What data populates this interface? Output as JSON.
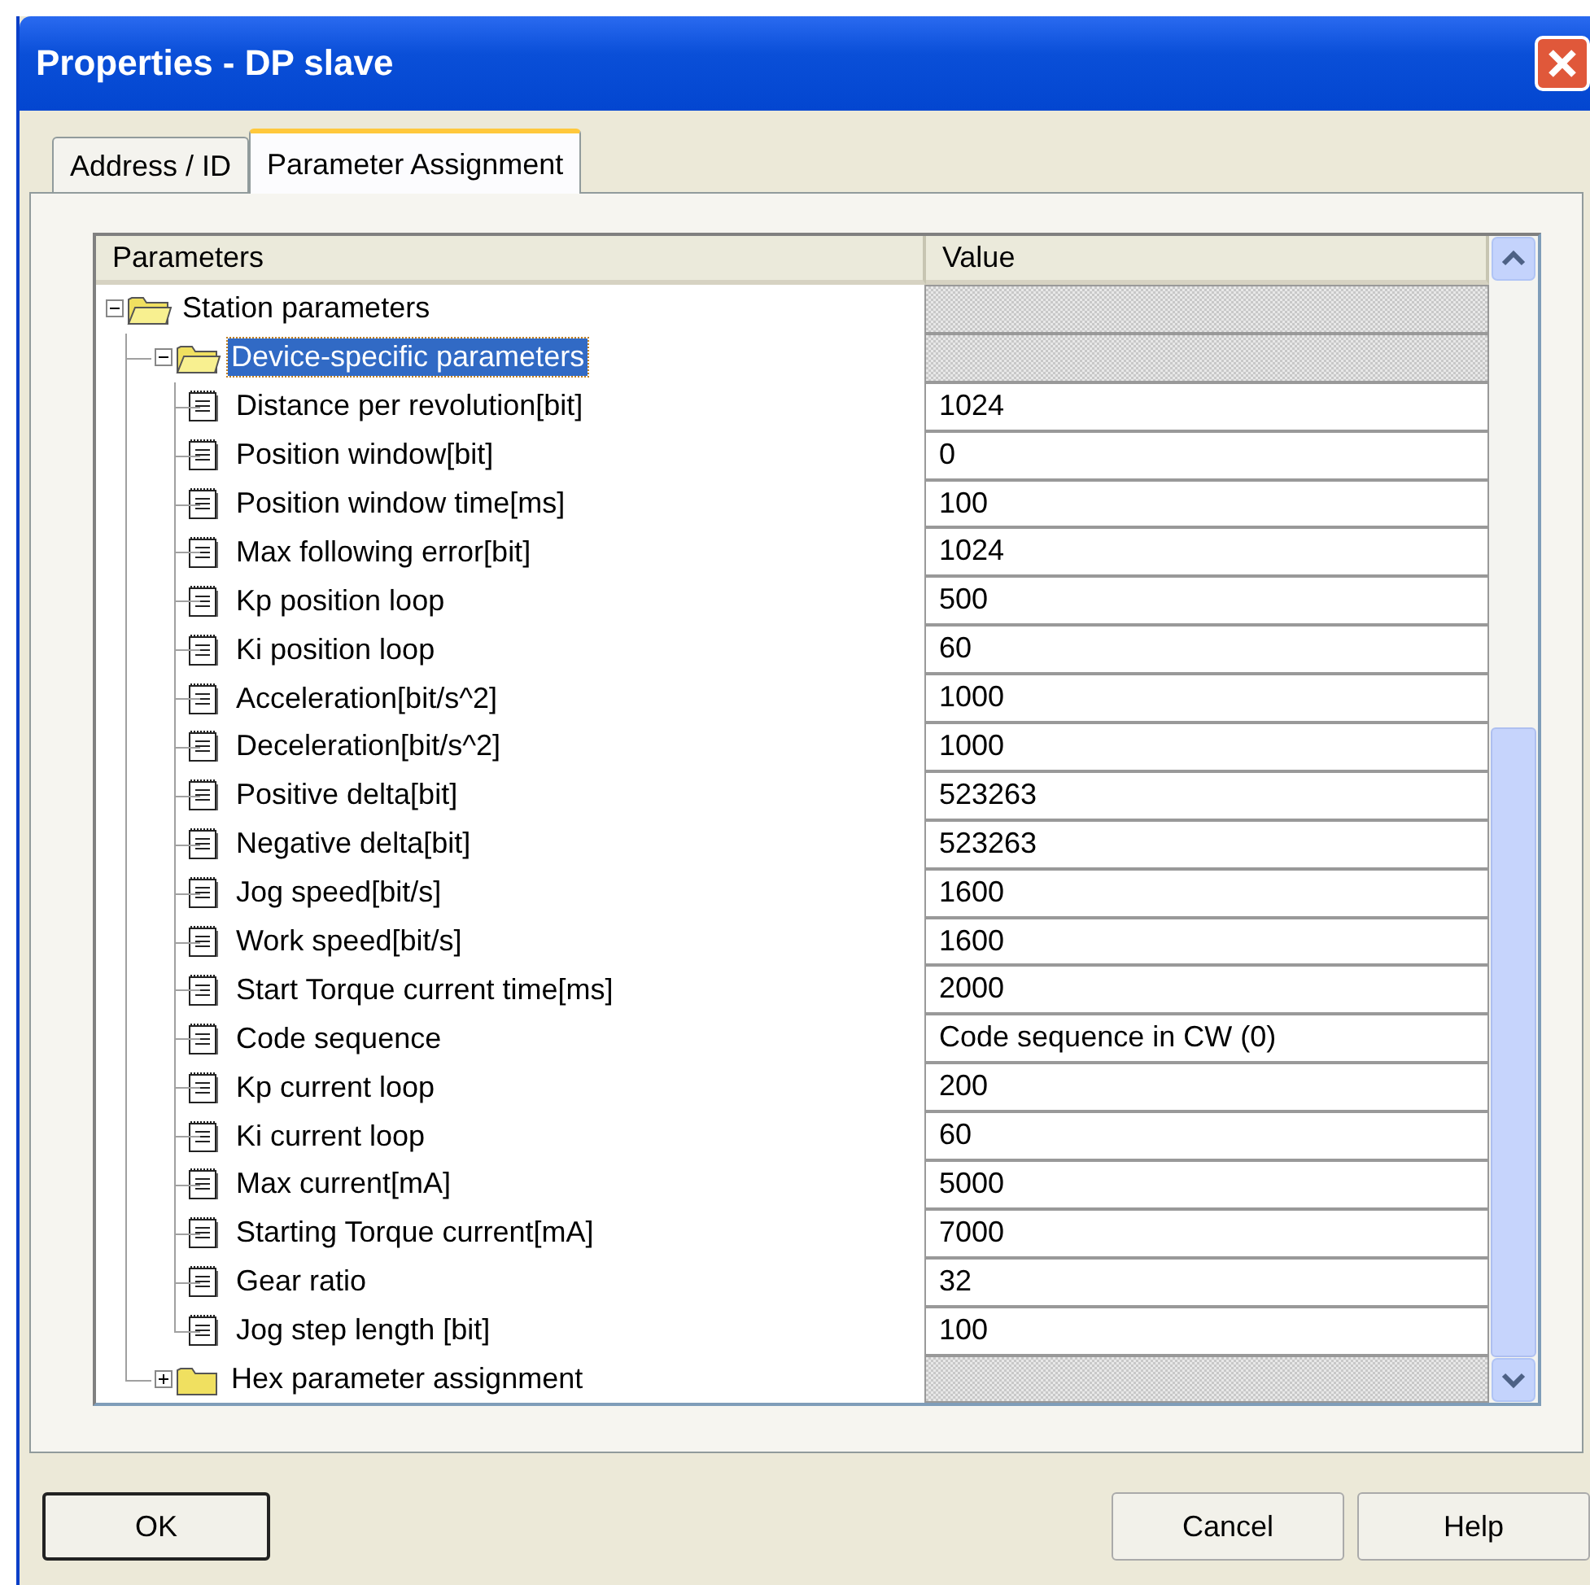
{
  "window": {
    "title": "Properties - DP slave"
  },
  "tabs": [
    {
      "label": "Address / ID",
      "selected": false
    },
    {
      "label": "Parameter Assignment",
      "selected": true
    }
  ],
  "table": {
    "columns": [
      "Parameters",
      "Value"
    ],
    "tree": [
      {
        "kind": "folder",
        "label": "Station parameters",
        "expanded": true,
        "selected": false,
        "children": [
          {
            "kind": "folder",
            "label": "Device-specific parameters",
            "expanded": true,
            "selected": true,
            "children": [
              {
                "kind": "param",
                "label": "Distance per revolution[bit]",
                "value": "1024",
                "selected": false
              },
              {
                "kind": "param",
                "label": "Position window[bit]",
                "value": "0",
                "selected": false
              },
              {
                "kind": "param",
                "label": "Position window time[ms]",
                "value": "100",
                "selected": false
              },
              {
                "kind": "param",
                "label": "Max following error[bit]",
                "value": "1024",
                "selected": false
              },
              {
                "kind": "param",
                "label": "Kp position loop",
                "value": "500",
                "selected": false
              },
              {
                "kind": "param",
                "label": "Ki position loop",
                "value": "60",
                "selected": false
              },
              {
                "kind": "param",
                "label": "Acceleration[bit/s^2]",
                "value": "1000",
                "selected": false
              },
              {
                "kind": "param",
                "label": "Deceleration[bit/s^2]",
                "value": "1000",
                "selected": false
              },
              {
                "kind": "param",
                "label": "Positive delta[bit]",
                "value": "523263",
                "selected": false
              },
              {
                "kind": "param",
                "label": "Negative delta[bit]",
                "value": "523263",
                "selected": false
              },
              {
                "kind": "param",
                "label": "Jog speed[bit/s]",
                "value": "1600",
                "selected": false
              },
              {
                "kind": "param",
                "label": "Work speed[bit/s]",
                "value": "1600",
                "selected": false
              },
              {
                "kind": "param",
                "label": "Start Torque current time[ms]",
                "value": "2000",
                "selected": false
              },
              {
                "kind": "param",
                "label": "Code sequence",
                "value": "Code sequence in CW (0)",
                "selected": false
              },
              {
                "kind": "param",
                "label": "Kp current loop",
                "value": "200",
                "selected": false
              },
              {
                "kind": "param",
                "label": "Ki current loop",
                "value": "60",
                "selected": false
              },
              {
                "kind": "param",
                "label": "Max current[mA]",
                "value": "5000",
                "selected": false
              },
              {
                "kind": "param",
                "label": "Starting Torque current[mA]",
                "value": "7000",
                "selected": false
              },
              {
                "kind": "param",
                "label": "Gear ratio",
                "value": "32",
                "selected": false
              },
              {
                "kind": "param",
                "label": "Jog step length [bit]",
                "value": "100",
                "selected": false
              }
            ]
          },
          {
            "kind": "folder",
            "label": "Hex parameter assignment",
            "expanded": false,
            "selected": false
          }
        ]
      }
    ]
  },
  "buttons": [
    {
      "label": "OK",
      "default": true
    },
    {
      "label": "Cancel",
      "default": false
    },
    {
      "label": "Help",
      "default": false
    }
  ]
}
